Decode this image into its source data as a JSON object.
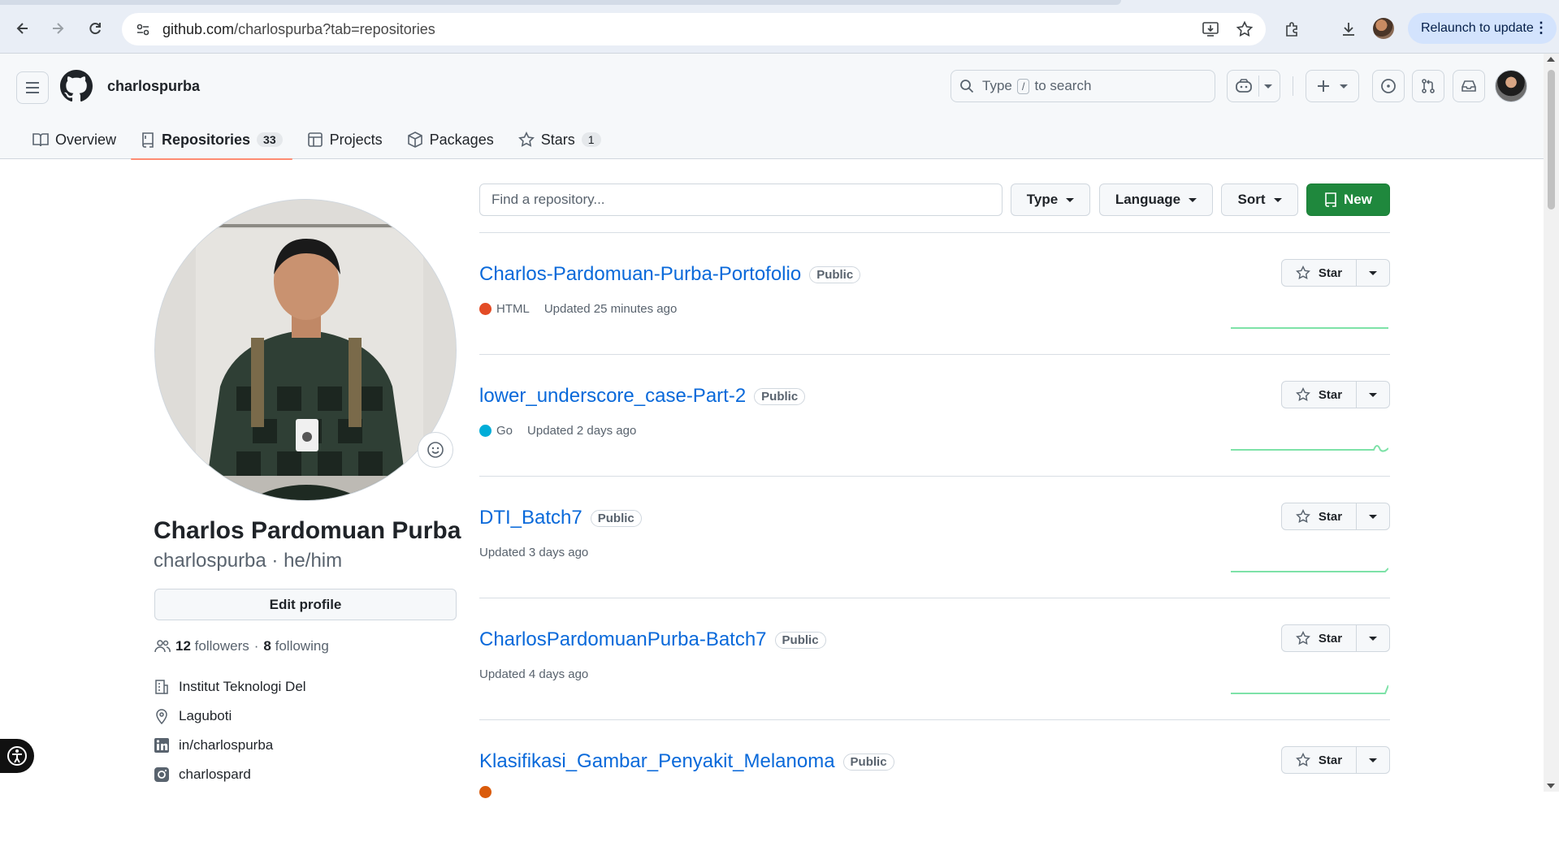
{
  "browser": {
    "url_host": "github.com",
    "url_rest": "/charlospurba?tab=repositories",
    "relaunch_label": "Relaunch to update"
  },
  "header": {
    "username": "charlospurba",
    "search_prefix": "Type",
    "search_key": "/",
    "search_suffix": "to search"
  },
  "tabs": [
    {
      "label": "Overview",
      "icon": "book-icon"
    },
    {
      "label": "Repositories",
      "count": "33",
      "icon": "repo-icon",
      "selected": true
    },
    {
      "label": "Projects",
      "icon": "table-icon"
    },
    {
      "label": "Packages",
      "icon": "package-icon"
    },
    {
      "label": "Stars",
      "count": "1",
      "icon": "star-icon"
    }
  ],
  "profile": {
    "name": "Charlos Pardomuan Purba",
    "login_line": "charlospurba · he/him",
    "edit_label": "Edit profile",
    "followers_count": "12",
    "followers_label": "followers",
    "following_count": "8",
    "following_label": "following",
    "separator": "·",
    "organization": "Institut Teknologi Del",
    "location": "Laguboti",
    "linkedin": "in/charlospurba",
    "instagram": "charlospard"
  },
  "filters": {
    "find_placeholder": "Find a repository...",
    "type_label": "Type",
    "language_label": "Language",
    "sort_label": "Sort",
    "new_label": "New"
  },
  "repos": [
    {
      "name": "Charlos-Pardomuan-Purba-Portofolio",
      "visibility": "Public",
      "language": "HTML",
      "language_color": "#e34c26",
      "updated": "Updated 25 minutes ago",
      "star_label": "Star"
    },
    {
      "name": "lower_underscore_case-Part-2",
      "visibility": "Public",
      "language": "Go",
      "language_color": "#00add8",
      "updated": "Updated 2 days ago",
      "star_label": "Star"
    },
    {
      "name": "DTI_Batch7",
      "visibility": "Public",
      "language": "",
      "updated": "Updated 3 days ago",
      "star_label": "Star"
    },
    {
      "name": "CharlosPardomuanPurba-Batch7",
      "visibility": "Public",
      "language": "",
      "updated": "Updated 4 days ago",
      "star_label": "Star"
    },
    {
      "name": "Klasifikasi_Gambar_Penyakit_Melanoma",
      "visibility": "Public",
      "language": "",
      "language_color": "#da5b0b",
      "updated": "",
      "star_label": "Star"
    }
  ],
  "colors": {
    "accent_link": "#0969da",
    "new_button": "#1f883d",
    "tab_underline": "#fd8c73",
    "sparkline": "#7ee2a8"
  }
}
